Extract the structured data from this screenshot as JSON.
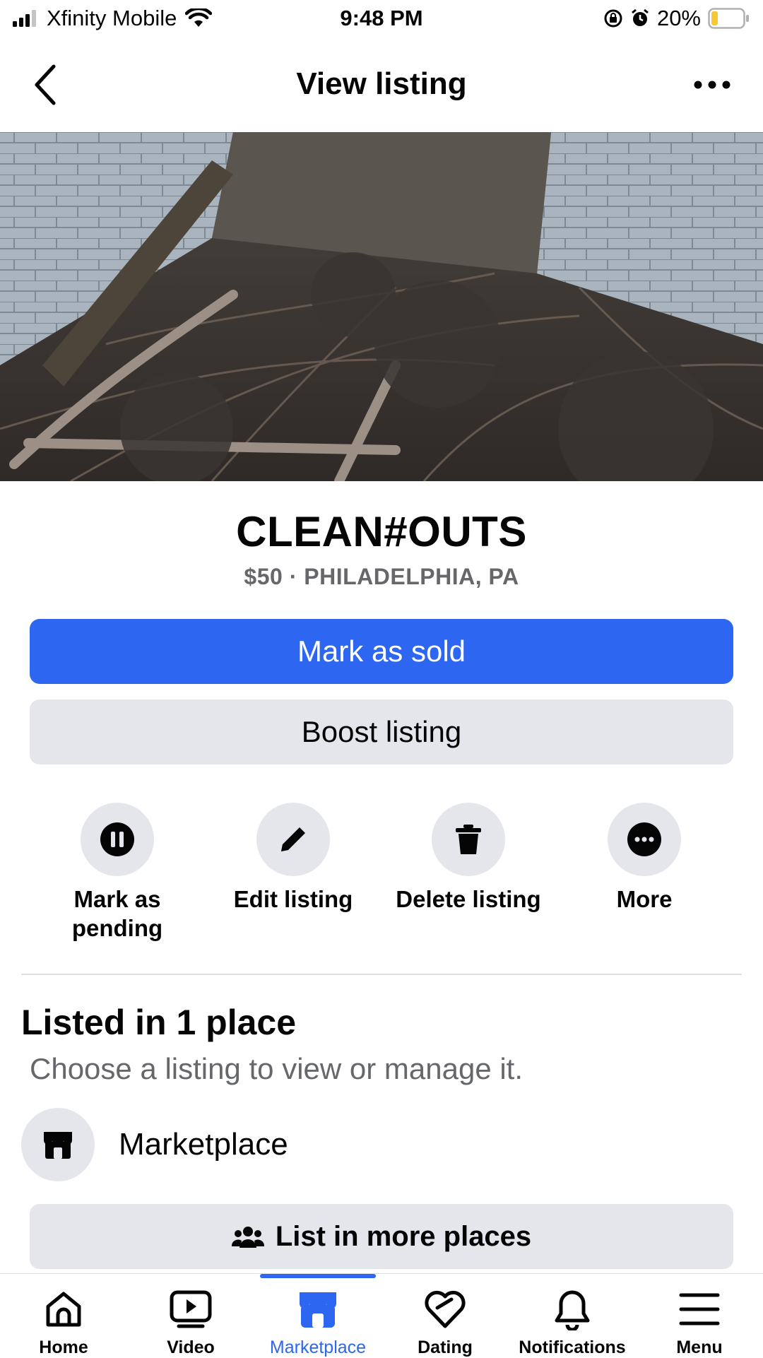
{
  "status_bar": {
    "carrier": "Xfinity Mobile",
    "time": "9:48 PM",
    "battery": "20%",
    "battery_level": 0.2
  },
  "header": {
    "title": "View listing"
  },
  "listing": {
    "title": "CLEAN#OUTS",
    "subtitle": "$50 · PHILADELPHIA, PA"
  },
  "buttons": {
    "mark_sold": "Mark as sold",
    "boost": "Boost listing",
    "list_more": "List in more places"
  },
  "actions": [
    {
      "label": "Mark as pending",
      "icon": "pause-icon"
    },
    {
      "label": "Edit listing",
      "icon": "pencil-icon"
    },
    {
      "label": "Delete listing",
      "icon": "trash-icon"
    },
    {
      "label": "More",
      "icon": "more-dots-icon"
    }
  ],
  "places": {
    "title": "Listed in 1 place",
    "subtitle": "Choose a listing to view or manage it.",
    "items": [
      {
        "label": "Marketplace",
        "icon": "storefront-icon"
      }
    ]
  },
  "bottom_nav": {
    "active": "Marketplace",
    "items": [
      {
        "label": "Home",
        "icon": "home-icon"
      },
      {
        "label": "Video",
        "icon": "video-icon"
      },
      {
        "label": "Marketplace",
        "icon": "marketplace-icon"
      },
      {
        "label": "Dating",
        "icon": "dating-icon"
      },
      {
        "label": "Notifications",
        "icon": "bell-icon"
      },
      {
        "label": "Menu",
        "icon": "menu-icon"
      }
    ]
  },
  "colors": {
    "accent": "#2d66f0",
    "button_gray": "#e4e6eb",
    "secondary_text": "#65676b",
    "battery_fill": "#f7c834"
  }
}
